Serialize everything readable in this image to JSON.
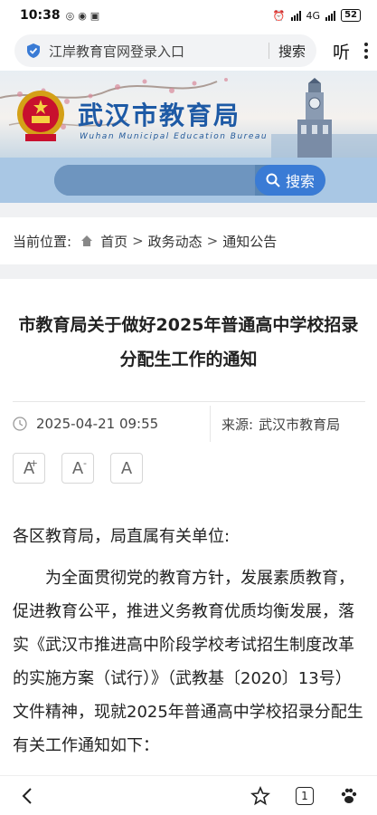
{
  "status_bar": {
    "time": "10:38",
    "network_label": "4G",
    "battery": "52"
  },
  "browser": {
    "url_text": "江岸教育官网登录入口",
    "search_label": "搜索",
    "listen_label": "听"
  },
  "banner": {
    "title": "武汉市教育局",
    "subtitle": "Wuhan Municipal Education Bureau",
    "search_button": "搜索"
  },
  "breadcrumb": {
    "label": "当前位置:",
    "items": [
      "首页",
      "政务动态",
      "通知公告"
    ],
    "separator": ">"
  },
  "article": {
    "title": "市教育局关于做好2025年普通高中学校招录分配生工作的通知",
    "date": "2025-04-21 09:55",
    "source_label": "来源:",
    "source": "武汉市教育局",
    "font_buttons": [
      "A",
      "A",
      "A"
    ],
    "font_button_marks": [
      "+",
      "-",
      ""
    ],
    "salutation": "各区教育局，局直属有关单位:",
    "paragraph_1": "为全面贯彻党的教育方针，发展素质教育，促进教育公平，推进义务教育优质均衡发展，落实《武汉市推进高中阶段学校考试招生制度改革的实施方案（试行）》（武教基〔2020〕13号）文件精神，现就2025年普通高中学校招录分配生有关工作通知如下："
  },
  "bottom_nav": {
    "tab_count": "1"
  },
  "colors": {
    "brand_blue": "#1e5aa5",
    "search_button": "#3a7bd5",
    "search_band": "#a9c7e4"
  }
}
